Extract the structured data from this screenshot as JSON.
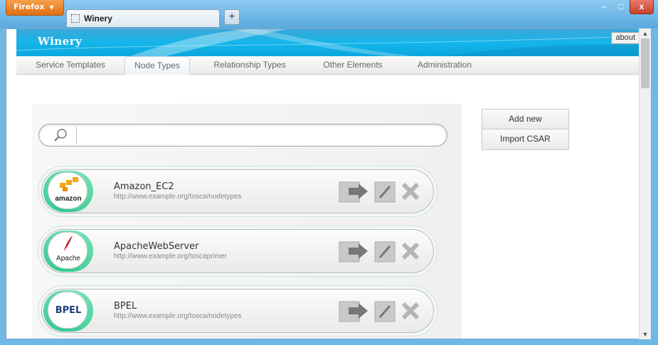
{
  "browser": {
    "menu_label": "Firefox",
    "tab_title": "Winery",
    "new_tab_label": "+",
    "window_controls": {
      "minimize": "–",
      "maximize": "□",
      "close": "x"
    }
  },
  "header": {
    "brand": "Winery",
    "about_label": "about"
  },
  "nav": {
    "items": [
      {
        "label": "Service Templates",
        "active": false
      },
      {
        "label": "Node Types",
        "active": true
      },
      {
        "label": "Relationship Types",
        "active": false
      },
      {
        "label": "Other Elements",
        "active": false
      },
      {
        "label": "Administration",
        "active": false
      }
    ]
  },
  "search": {
    "value": "",
    "placeholder": ""
  },
  "actions": {
    "add_new_label": "Add new",
    "import_label": "Import CSAR"
  },
  "node_types": [
    {
      "name": "Amazon_EC2",
      "namespace": "http://www.example.org/tosca/nodetypes",
      "logo_text": "amazon",
      "logo_icon": "amazon-boxes-icon"
    },
    {
      "name": "ApacheWebServer",
      "namespace": "http://www.example.org/toscaprimer",
      "logo_text": "Apache",
      "logo_icon": "apache-feather-icon"
    },
    {
      "name": "BPEL",
      "namespace": "http://www.example.org/tosca/nodetypes",
      "logo_text": "BPEL",
      "logo_icon": "bpel-text-icon"
    }
  ],
  "colors": {
    "banner": "#14b5ea",
    "card_accent": "#2fc98f",
    "firefox_button": "#e8821f"
  }
}
